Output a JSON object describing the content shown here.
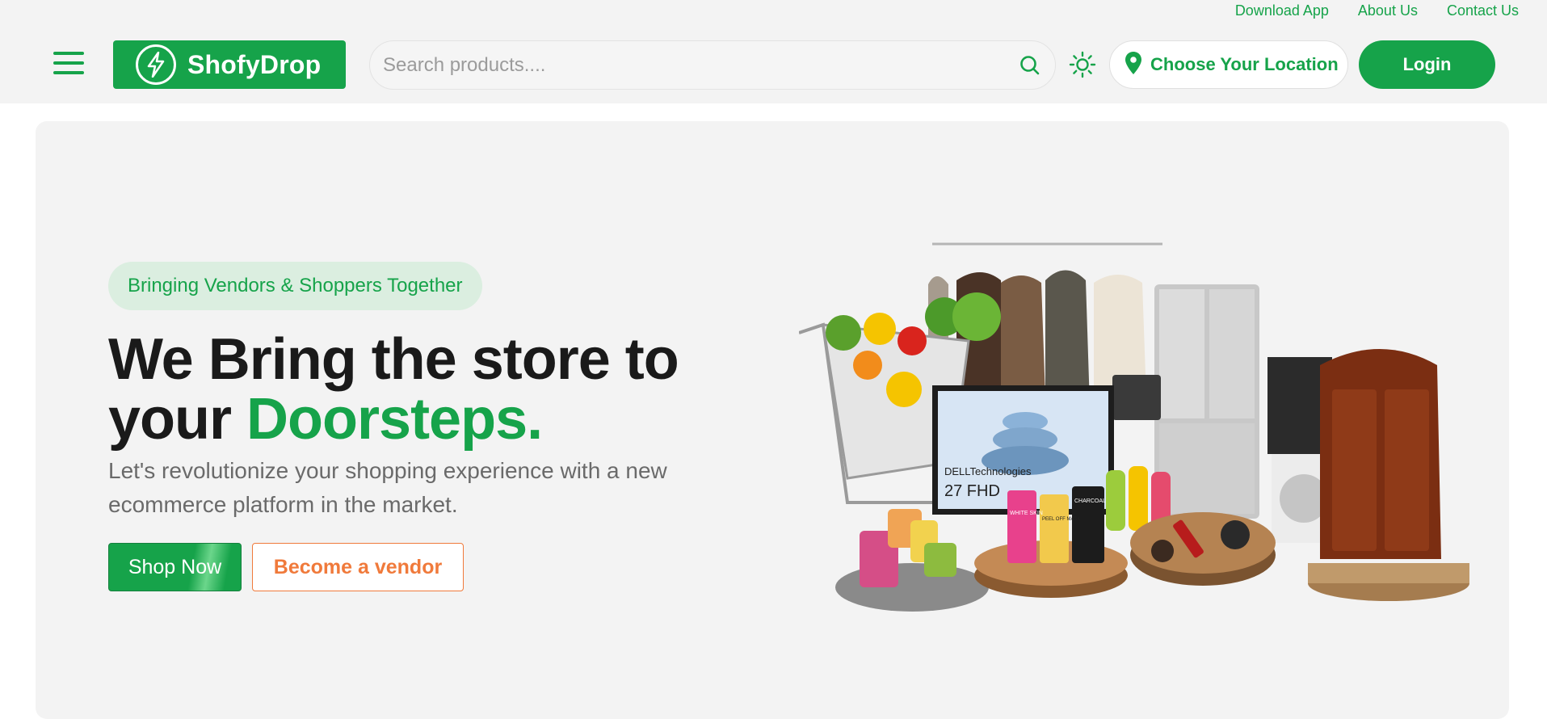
{
  "top_links": {
    "download_app": "Download App",
    "about_us": "About Us",
    "contact_us": "Contact Us"
  },
  "header": {
    "menu_icon": "hamburger-menu-icon",
    "logo": {
      "text": "ShofyDrop",
      "icon": "lightning-bolt-icon"
    },
    "search": {
      "placeholder": "Search products....",
      "icon": "search-icon"
    },
    "theme_icon": "sun-icon",
    "location": {
      "label": "Choose Your Location",
      "icon": "map-pin-icon"
    },
    "login_label": "Login"
  },
  "hero": {
    "tagline": "Bringing Vendors & Shoppers Together",
    "headline_prefix": "We Bring the store to your",
    "headline_accent": "Doorsteps.",
    "subtext": "Let's revolutionize your shopping experience with a new ecommerce platform in the market.",
    "shop_now": "Shop Now",
    "become_vendor": "Become a vendor",
    "monitor_brand": "DELLTechnologies",
    "monitor_model": "27 FHD",
    "mask_labels": [
      "WHITE SKIN",
      "PEEL OFF MASK",
      "CHARCOAL"
    ]
  },
  "colors": {
    "brand_green": "#16a34a",
    "vendor_orange": "#f07a3b",
    "pill_bg": "#dbeee0"
  }
}
